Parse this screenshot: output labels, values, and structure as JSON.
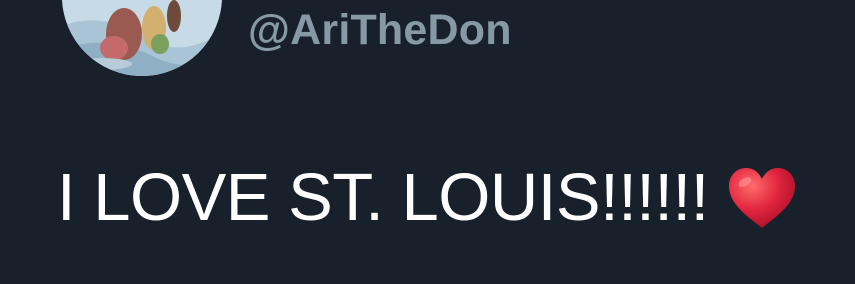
{
  "tweet": {
    "handle": "@AriTheDon",
    "text": "I LOVE ST. LOUIS!!!!!!",
    "emoji": "red-heart",
    "avatar_alt": "profile photo"
  },
  "colors": {
    "background": "#17202b",
    "handle": "#8899a6",
    "text": "#ffffff",
    "heart": "#e0243d"
  }
}
